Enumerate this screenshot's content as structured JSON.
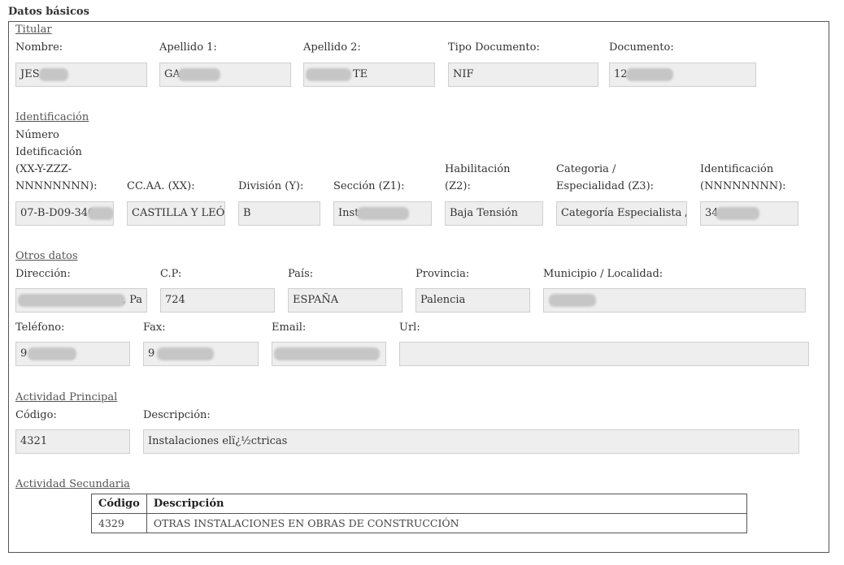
{
  "page": {
    "title": "Datos básicos"
  },
  "titular": {
    "section": "Titular",
    "nombre_label": "Nombre:",
    "nombre_value": "JES",
    "apellido1_label": "Apellido 1:",
    "apellido1_value": "GA",
    "apellido2_label": "Apellido 2:",
    "apellido2_value": "TE",
    "tipo_doc_label": "Tipo Documento:",
    "tipo_doc_value": "NIF",
    "documento_label": "Documento:",
    "documento_value": "12"
  },
  "identificacion": {
    "section": "Identificación",
    "numero_label_1": "Número",
    "numero_label_2": "Idetificación",
    "numero_label_3": "(XX-Y-ZZZ-",
    "numero_label_4": "NNNNNNNN):",
    "numero_value": "07-B-D09-340",
    "ccaa_label": "CC.AA. (XX):",
    "ccaa_value": "CASTILLA Y LEÓN",
    "division_label": "División (Y):",
    "division_value": "B",
    "seccion_label": "Sección (Z1):",
    "seccion_value": "Inst",
    "habilitacion_label_1": "Habilitación",
    "habilitacion_label_2": "(Z2):",
    "habilitacion_value": "Baja Tensión",
    "categoria_label_1": "Categoria /",
    "categoria_label_2": "Especialidad (Z3):",
    "categoria_value": "Categoría Especialista / I",
    "ident_label_1": "Identificación",
    "ident_label_2": "(NNNNNNNN):",
    "ident_value": "34"
  },
  "otros": {
    "section": "Otros datos",
    "direccion_label": "Dirección:",
    "direccion_value": ", Pa",
    "cp_label": "C.P:",
    "cp_value": "724",
    "pais_label": "País:",
    "pais_value": "ESPAÑA",
    "provincia_label": "Provincia:",
    "provincia_value": "Palencia",
    "municipio_label": "Municipio / Localidad:",
    "municipio_value": "",
    "telefono_label": "Teléfono:",
    "telefono_value": "9",
    "fax_label": "Fax:",
    "fax_value": "9",
    "email_label": "Email:",
    "email_value": "",
    "url_label": "Url:",
    "url_value": ""
  },
  "actividad_principal": {
    "section": "Actividad Principal",
    "codigo_label": "Código:",
    "codigo_value": "4321",
    "descripcion_label": "Descripción:",
    "descripcion_value": "Instalaciones elï¿½ctricas"
  },
  "actividad_secundaria": {
    "section": "Actividad Secundaria",
    "headers": [
      "Código",
      "Descripción"
    ],
    "rows": [
      {
        "codigo": "4329",
        "descripcion": "OTRAS INSTALACIONES EN OBRAS DE CONSTRUCCIÓN"
      }
    ]
  }
}
